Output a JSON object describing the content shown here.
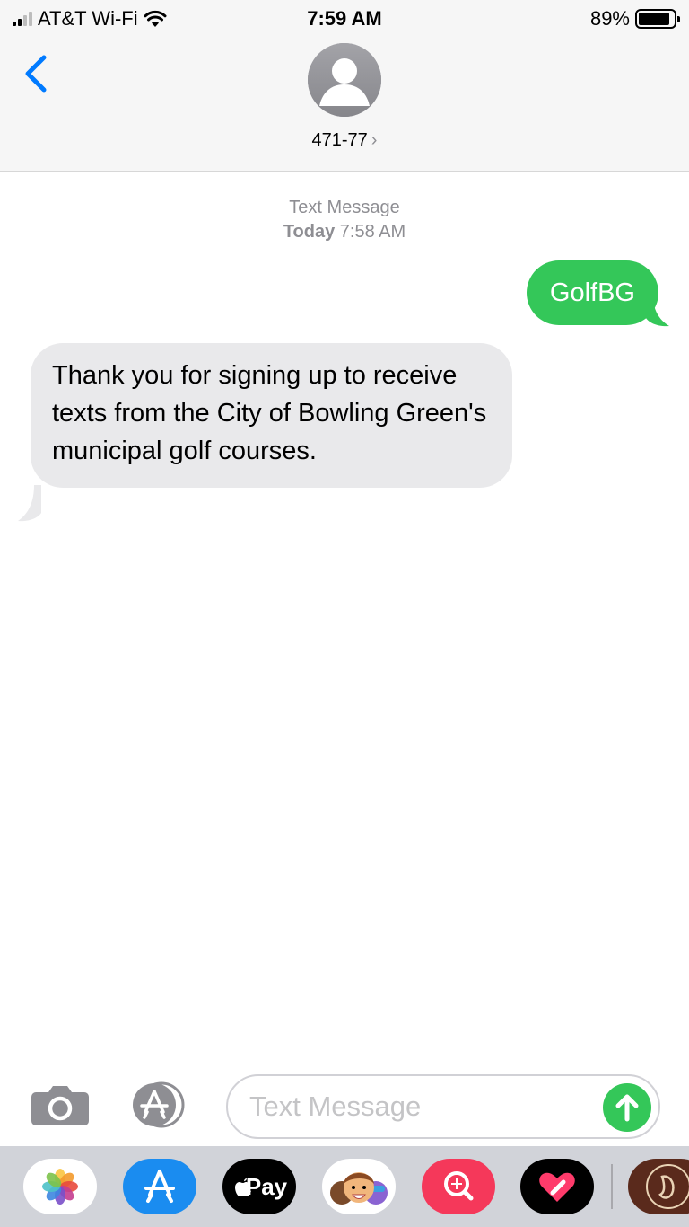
{
  "status_bar": {
    "carrier": "AT&T Wi-Fi",
    "time": "7:59 AM",
    "battery_text": "89%",
    "battery_level": 0.89,
    "signal_bars": 2
  },
  "header": {
    "contact_name": "471-77",
    "contact_chevron": "›",
    "back_icon": "chevron-left-icon",
    "avatar_icon": "person-icon"
  },
  "conversation": {
    "service_label": "Text Message",
    "day_label": "Today",
    "time_label": "7:58 AM",
    "messages": [
      {
        "direction": "outgoing",
        "text": "GolfBG"
      },
      {
        "direction": "incoming",
        "text": "Thank you for signing up to receive texts from the City of Bowling Green's municipal golf courses."
      }
    ]
  },
  "composer": {
    "placeholder": "Text Message",
    "value": "",
    "camera_icon": "camera-icon",
    "apps_icon": "app-store-icon",
    "send_icon": "arrow-up-icon"
  },
  "app_drawer": {
    "apps": [
      {
        "name": "Photos",
        "icon": "photos-icon"
      },
      {
        "name": "App Store",
        "icon": "app-store-icon"
      },
      {
        "name": "Apple Pay",
        "label": "Pay",
        "icon": "apple-pay-icon"
      },
      {
        "name": "Memoji",
        "icon": "memoji-icon"
      },
      {
        "name": "Images Search",
        "icon": "image-search-icon"
      },
      {
        "name": "Digital Touch",
        "icon": "digital-touch-icon"
      },
      {
        "name": "Chipotle",
        "icon": "chipotle-icon"
      }
    ]
  },
  "colors": {
    "accent_blue": "#007aff",
    "sms_green": "#34c759",
    "incoming_bubble": "#e9e9eb",
    "header_bg": "#f6f6f6",
    "drawer_bg": "#d1d3d9"
  }
}
